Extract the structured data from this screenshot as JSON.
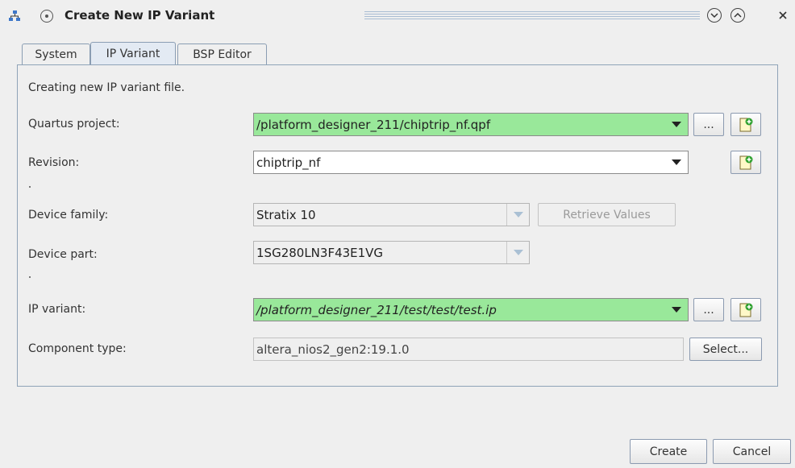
{
  "window": {
    "title": "Create New IP Variant"
  },
  "tabs": [
    {
      "label": "System"
    },
    {
      "label": "IP Variant"
    },
    {
      "label": "BSP Editor"
    }
  ],
  "form": {
    "intro": "Creating new IP variant file.",
    "quartus_project": {
      "label": "Quartus project:",
      "value": "/platform_designer_211/chiptrip_nf.qpf",
      "browse_label": "..."
    },
    "revision": {
      "label": "Revision:",
      "value": "chiptrip_nf"
    },
    "device_family": {
      "label": "Device family:",
      "value": "Stratix 10",
      "retrieve_label": "Retrieve Values"
    },
    "device_part": {
      "label": "Device part:",
      "value": "1SG280LN3F43E1VG"
    },
    "ip_variant": {
      "label": "IP variant:",
      "value": "/platform_designer_211/test/test/test.ip",
      "browse_label": "..."
    },
    "component_type": {
      "label": "Component type:",
      "value": "altera_nios2_gen2:19.1.0",
      "select_label": "Select..."
    }
  },
  "footer": {
    "create_label": "Create",
    "cancel_label": "Cancel"
  },
  "colors": {
    "valid_field": "#99e89a",
    "panel_border": "#8fa3b8",
    "background": "#efefef"
  },
  "icons": {
    "app": "network-tree-icon",
    "new_file": "new-file-plus-icon"
  }
}
